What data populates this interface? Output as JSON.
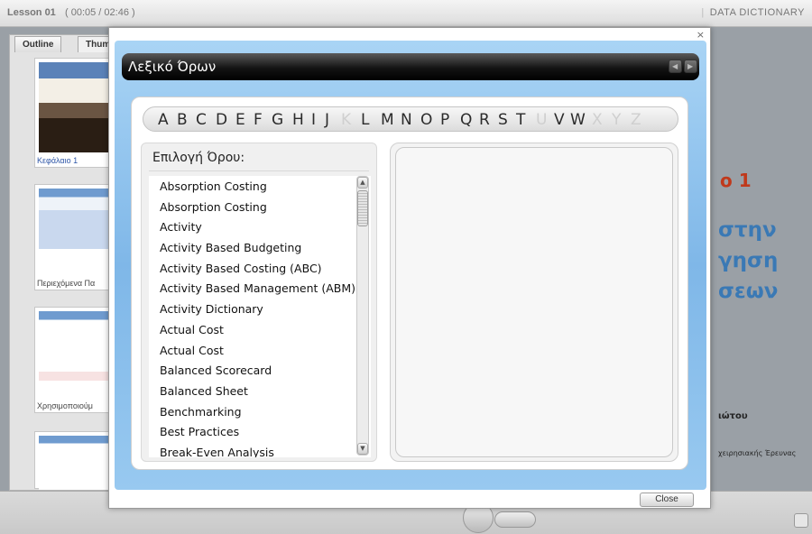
{
  "app": {
    "lesson_title": "Lesson 01",
    "lesson_time": "( 00:05 / 02:46 )",
    "right_label": "DATA DICTIONARY",
    "tabs": [
      "Outline",
      "Thum"
    ],
    "thumbnails": [
      {
        "label": "Κεφάλαιο 1"
      },
      {
        "label": "Περιεχόμενα Πα"
      },
      {
        "label": "Χρησιμοποιούμ"
      }
    ],
    "slide_fragments": [
      "ο 1",
      "στην",
      "γηση",
      "σεων",
      "ιώτου",
      "χειρησιακής Έρευνας"
    ]
  },
  "dialog": {
    "close_x": "×",
    "title": "Λεξικό Όρων",
    "letters": [
      {
        "ch": "A",
        "enabled": true
      },
      {
        "ch": "B",
        "enabled": true
      },
      {
        "ch": "C",
        "enabled": true
      },
      {
        "ch": "D",
        "enabled": true
      },
      {
        "ch": "E",
        "enabled": true
      },
      {
        "ch": "F",
        "enabled": true
      },
      {
        "ch": "G",
        "enabled": true
      },
      {
        "ch": "H",
        "enabled": true
      },
      {
        "ch": "I",
        "enabled": true
      },
      {
        "ch": "J",
        "enabled": true
      },
      {
        "ch": "K",
        "enabled": false
      },
      {
        "ch": "L",
        "enabled": true
      },
      {
        "ch": "M",
        "enabled": true
      },
      {
        "ch": "N",
        "enabled": true
      },
      {
        "ch": "O",
        "enabled": true
      },
      {
        "ch": "P",
        "enabled": true
      },
      {
        "ch": "Q",
        "enabled": true
      },
      {
        "ch": "R",
        "enabled": true
      },
      {
        "ch": "S",
        "enabled": true
      },
      {
        "ch": "T",
        "enabled": true
      },
      {
        "ch": "U",
        "enabled": false
      },
      {
        "ch": "V",
        "enabled": true
      },
      {
        "ch": "W",
        "enabled": true
      },
      {
        "ch": "X",
        "enabled": false
      },
      {
        "ch": "Y",
        "enabled": false
      },
      {
        "ch": "Z",
        "enabled": false
      }
    ],
    "term_heading": "Επιλογή Όρου:",
    "terms": [
      "Absorption Costing",
      "Absorption Costing",
      "Activity",
      "Activity Based Budgeting",
      "Activity Based Costing (ABC)",
      "Activity Based Management (ABM)",
      "Activity Dictionary",
      "Actual Cost",
      "Actual Cost",
      "Balanced Scorecard",
      "Balanced Sheet",
      "Benchmarking",
      "Best Practices",
      "Break-Even Analysis"
    ],
    "definition_text": "",
    "close_label": "Close"
  },
  "colors": {
    "dialog_blue": "#7fb7e8",
    "header_black": "#000000",
    "disabled_letter": "#cfcfcf",
    "slide_blue": "#3a79b5",
    "slide_red": "#c0391b"
  }
}
